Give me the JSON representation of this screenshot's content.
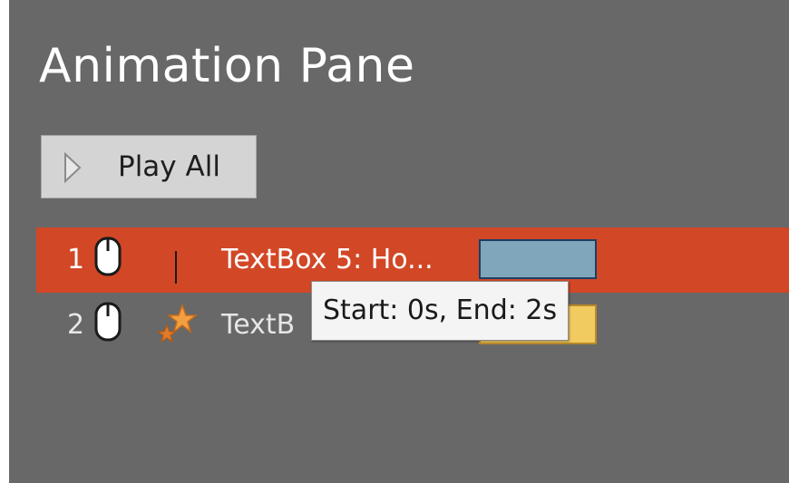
{
  "pane": {
    "title": "Animation Pane",
    "play_all_label": "Play All"
  },
  "animations": [
    {
      "number": "1",
      "trigger_icon": "mouse-click-icon",
      "effect_icon": "line-path-icon",
      "label": "TextBox 5: Ho...",
      "selected": true,
      "timing_bar_color": "#7fa6ba"
    },
    {
      "number": "2",
      "trigger_icon": "mouse-click-icon",
      "effect_icon": "star-effect-icon",
      "label": "TextB",
      "selected": false,
      "timing_bar_color": "#f2cb60"
    }
  ],
  "tooltip": {
    "text": "Start: 0s, End: 2s"
  },
  "colors": {
    "pane_background": "#686868",
    "selected_row": "#d24726",
    "button_background": "#d4d4d4"
  }
}
